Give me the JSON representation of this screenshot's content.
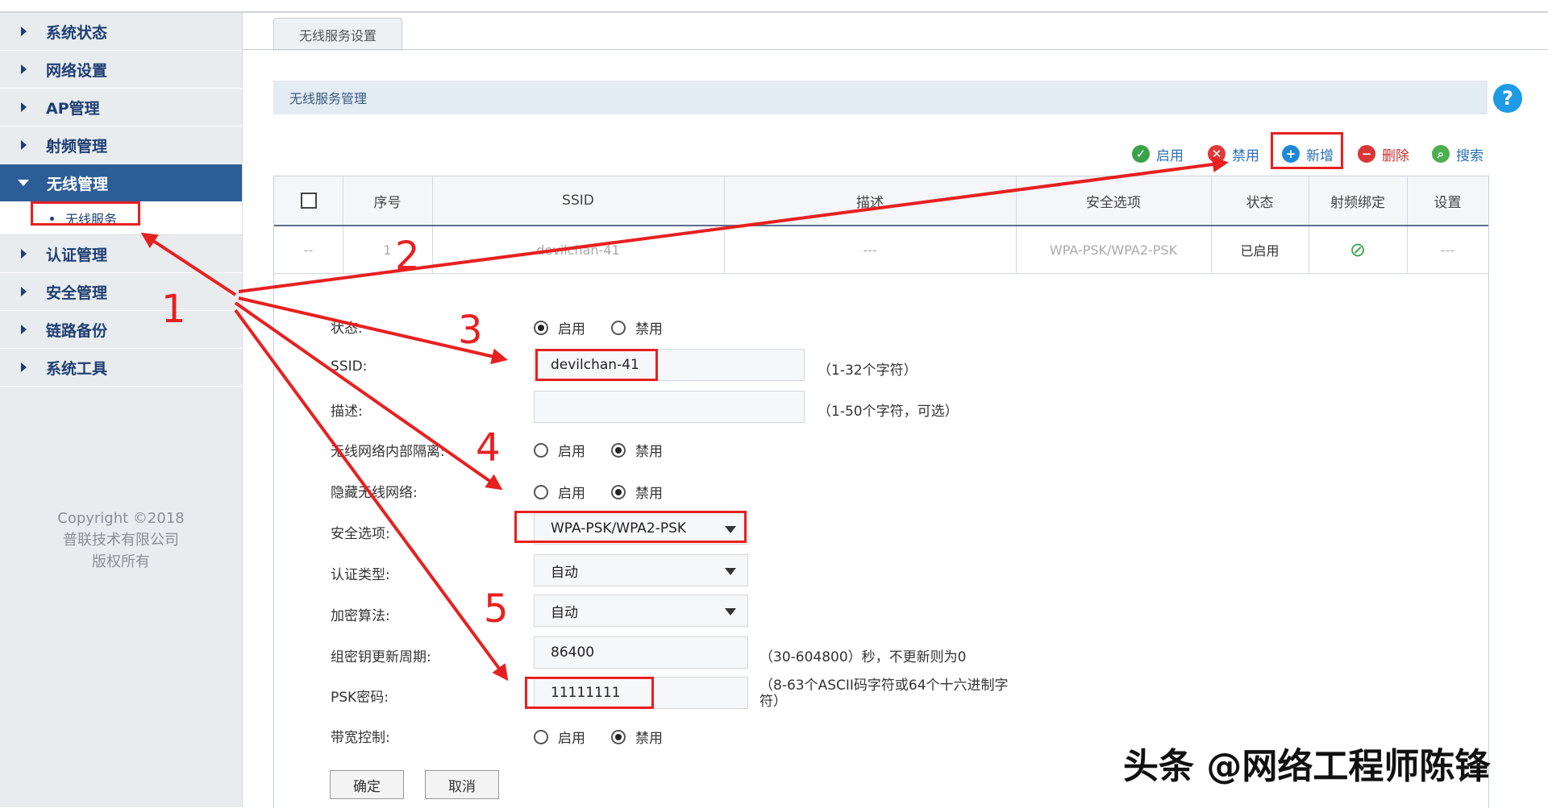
{
  "sidebar": {
    "items": [
      {
        "label": "系统状态"
      },
      {
        "label": "网络设置"
      },
      {
        "label": "AP管理"
      },
      {
        "label": "射频管理"
      },
      {
        "label": "无线管理",
        "active": true,
        "sub": "无线服务"
      },
      {
        "label": "认证管理"
      },
      {
        "label": "安全管理"
      },
      {
        "label": "链路备份"
      },
      {
        "label": "系统工具"
      }
    ],
    "copyright": [
      "Copyright ©2018",
      "普联技术有限公司",
      "版权所有"
    ]
  },
  "tab": "无线服务设置",
  "section_title": "无线服务管理",
  "help": "?",
  "toolbar": {
    "enable": "启用",
    "disable": "禁用",
    "add": "新增",
    "delete": "删除",
    "search": "搜索"
  },
  "table": {
    "headers": [
      "序号",
      "SSID",
      "描述",
      "安全选项",
      "状态",
      "射频绑定",
      "设置"
    ],
    "row": {
      "sel": "--",
      "index": "1",
      "ssid": "devilchan-41",
      "desc": "---",
      "security": "WPA-PSK/WPA2-PSK",
      "status": "已启用",
      "settings": "---"
    }
  },
  "form": {
    "status_label": "状态:",
    "ssid_label": "SSID:",
    "ssid_value": "devilchan-41",
    "ssid_hint": "（1-32个字符）",
    "desc_label": "描述:",
    "desc_hint": "（1-50个字符，可选）",
    "isolation_label": "无线网络内部隔离:",
    "hide_label": "隐藏无线网络:",
    "security_label": "安全选项:",
    "security_value": "WPA-PSK/WPA2-PSK",
    "auth_label": "认证类型:",
    "auth_value": "自动",
    "cipher_label": "加密算法:",
    "cipher_value": "自动",
    "rekey_label": "组密钥更新周期:",
    "rekey_value": "86400",
    "rekey_hint": "（30-604800）秒，不更新则为0",
    "psk_label": "PSK密码:",
    "psk_value": "11111111",
    "psk_hint_1": "（8-63个ASCII码字符或64个十六进制字",
    "psk_hint_2": "符）",
    "bw_label": "带宽控制:",
    "enable": "启用",
    "disable": "禁用",
    "ok": "确定",
    "cancel": "取消"
  },
  "annotations": [
    "1",
    "2",
    "3",
    "4",
    "5"
  ],
  "watermark": "头条 @网络工程师陈锋",
  "colors": {
    "accent": "#2d5d97",
    "annotation": "#e82020",
    "help": "#1e9be4"
  }
}
